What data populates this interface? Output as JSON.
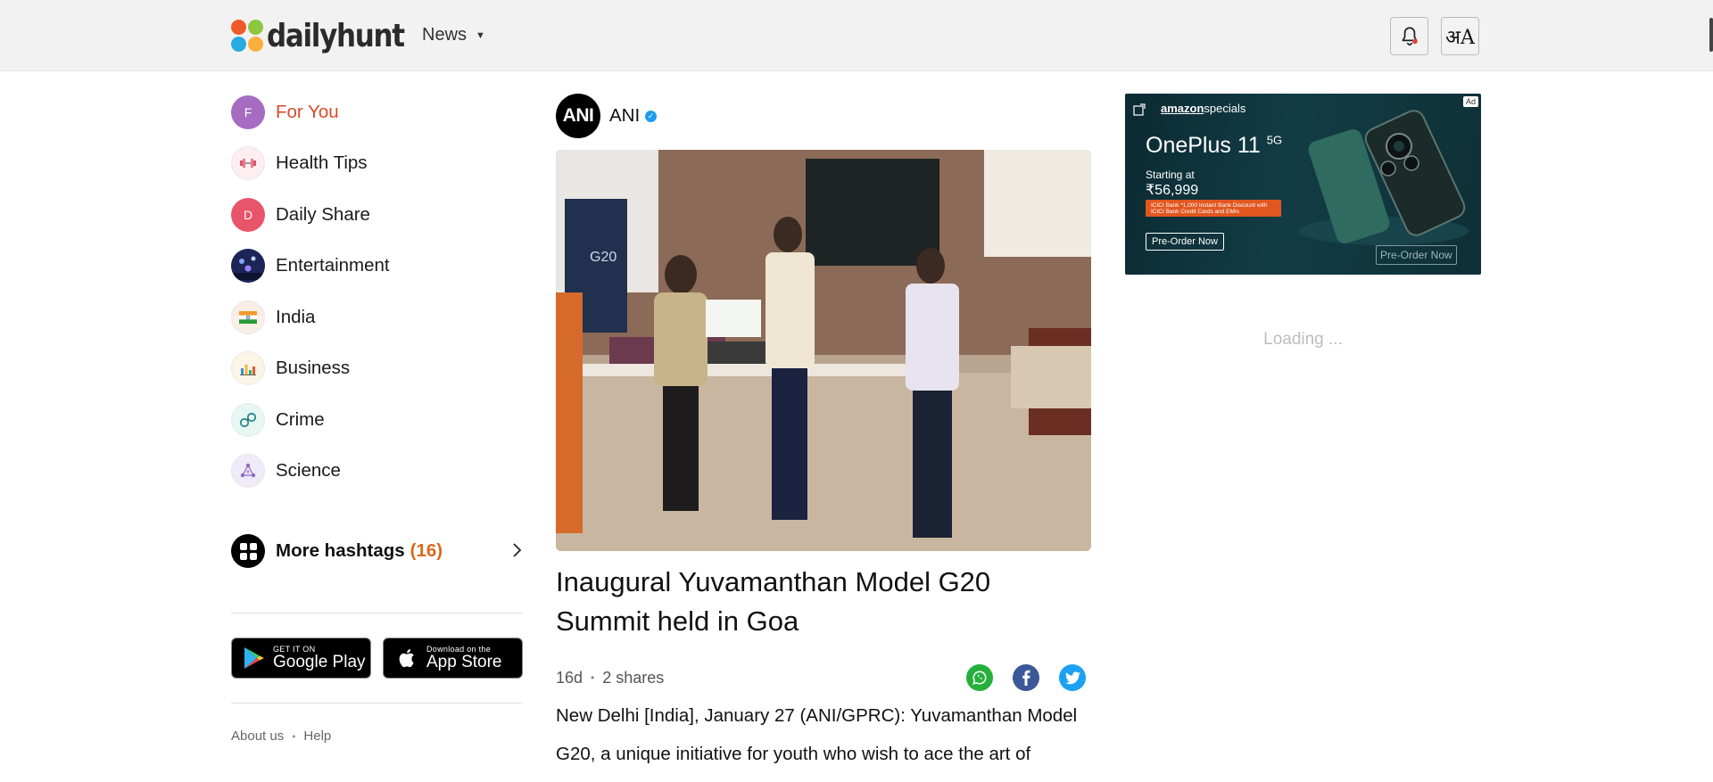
{
  "header": {
    "logo_text": "dailyhunt",
    "news_menu_label": "News",
    "language_button_label": "अA"
  },
  "sidebar": {
    "items": [
      {
        "label": "For You",
        "icon_letter": "F",
        "icon": "letter-avatar",
        "color": "#a56cc1",
        "active": true
      },
      {
        "label": "Health Tips",
        "icon_letter": "",
        "icon": "dumbbell-icon",
        "color": "#fdeef0",
        "active": false
      },
      {
        "label": "Daily Share",
        "icon_letter": "D",
        "icon": "letter-avatar",
        "color": "#e8546a",
        "active": false
      },
      {
        "label": "Entertainment",
        "icon_letter": "",
        "icon": "concert-icon",
        "color": "#2a3a7a",
        "active": false
      },
      {
        "label": "India",
        "icon_letter": "",
        "icon": "india-flag-icon",
        "color": "#fbeee6",
        "active": false
      },
      {
        "label": "Business",
        "icon_letter": "",
        "icon": "bar-chart-icon",
        "color": "#fcf5e6",
        "active": false
      },
      {
        "label": "Crime",
        "icon_letter": "",
        "icon": "handcuffs-icon",
        "color": "#e7f7f3",
        "active": false
      },
      {
        "label": "Science",
        "icon_letter": "",
        "icon": "molecule-icon",
        "color": "#f1eaf8",
        "active": false
      }
    ],
    "more_hashtags_label": "More hashtags",
    "more_hashtags_count": "(16)",
    "google_play": {
      "small": "GET IT ON",
      "big": "Google Play"
    },
    "app_store": {
      "small": "Download on the",
      "big": "App Store"
    },
    "footer": {
      "about": "About us",
      "help": "Help"
    }
  },
  "article": {
    "source_logo_text": "ANI",
    "source_name": "ANI",
    "headline": "Inaugural Yuvamanthan Model G20 Summit held in Goa",
    "age": "16d",
    "shares": "2 shares",
    "body": "New Delhi [India], January 27 (ANI/GPRC): Yuvamanthan Model G20, a unique initiative for youth who wish to ace the art of"
  },
  "ad": {
    "badge": "Ad",
    "brand_prefix": "amazon",
    "brand_suffix": "specials",
    "title": "OnePlus 11",
    "title_sup": "5G",
    "starting_at": "Starting at",
    "price": "₹56,999",
    "bank_offer": "ICICI Bank  *1,000 Instant Bank Discount with ICICI Bank Credit Cards and EMIs",
    "cta": "Pre-Order Now",
    "cta_ghost": "Pre-Order Now"
  },
  "right_loading": "Loading ...",
  "colors": {
    "accent_red": "#d94a2b",
    "count_orange": "#d9691f",
    "whatsapp": "#25b03b",
    "facebook": "#3b5998",
    "twitter": "#1da1f2"
  }
}
